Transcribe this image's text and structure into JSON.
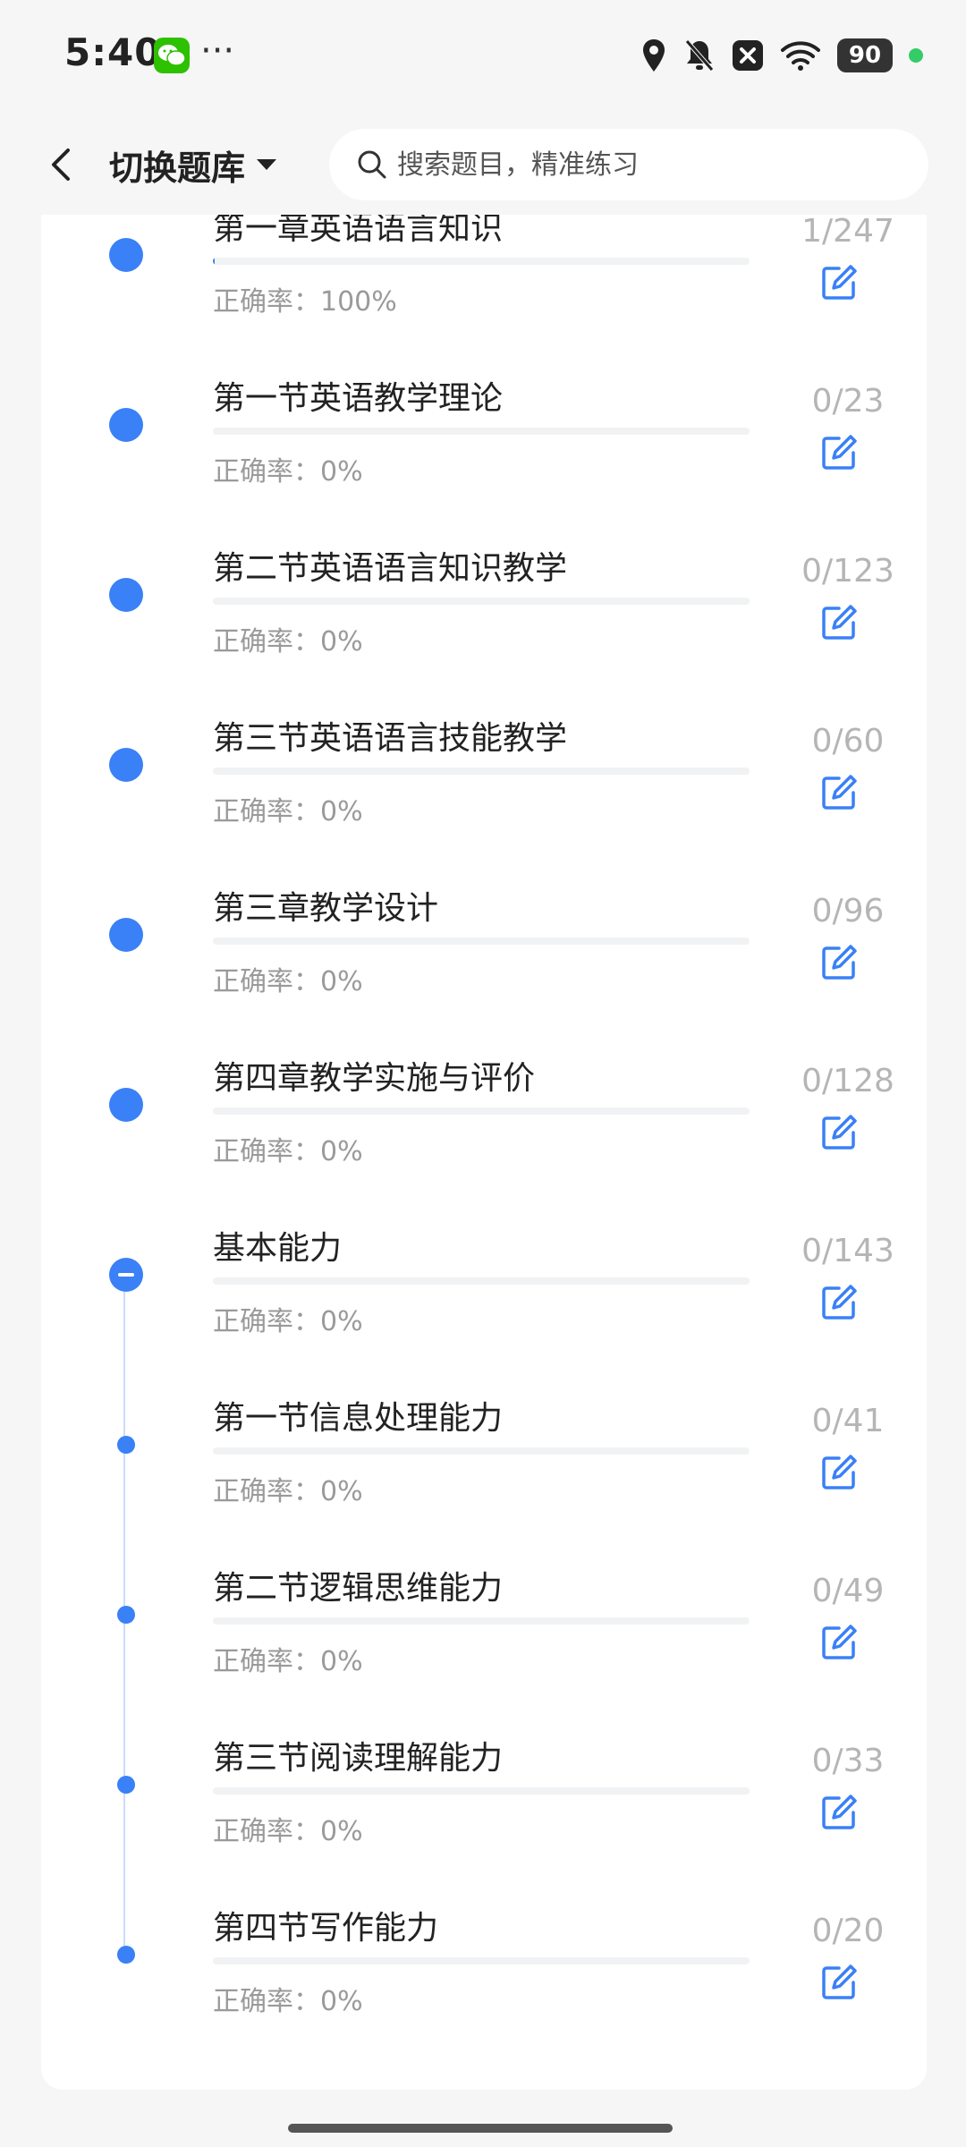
{
  "status_bar": {
    "time": "5:40",
    "dots": "···",
    "battery": "90"
  },
  "header": {
    "bank_switch_label": "切换题库",
    "search_placeholder": "搜索题目，精准练习"
  },
  "rows": [
    {
      "title": "第一章英语语言知识",
      "accuracy": "正确率：100%",
      "count": "1/247",
      "progress": 0.004,
      "dot": "large"
    },
    {
      "title": "第一节英语教学理论",
      "accuracy": "正确率：0%",
      "count": "0/23",
      "progress": 0,
      "dot": "large"
    },
    {
      "title": "第二节英语语言知识教学",
      "accuracy": "正确率：0%",
      "count": "0/123",
      "progress": 0,
      "dot": "large"
    },
    {
      "title": "第三节英语语言技能教学",
      "accuracy": "正确率：0%",
      "count": "0/60",
      "progress": 0,
      "dot": "large"
    },
    {
      "title": "第三章教学设计",
      "accuracy": "正确率：0%",
      "count": "0/96",
      "progress": 0,
      "dot": "large"
    },
    {
      "title": "第四章教学实施与评价",
      "accuracy": "正确率：0%",
      "count": "0/128",
      "progress": 0,
      "dot": "large"
    },
    {
      "title": "基本能力",
      "accuracy": "正确率：0%",
      "count": "0/143",
      "progress": 0,
      "dot": "collapse"
    },
    {
      "title": "第一节信息处理能力",
      "accuracy": "正确率：0%",
      "count": "0/41",
      "progress": 0,
      "dot": "small"
    },
    {
      "title": "第二节逻辑思维能力",
      "accuracy": "正确率：0%",
      "count": "0/49",
      "progress": 0,
      "dot": "small"
    },
    {
      "title": "第三节阅读理解能力",
      "accuracy": "正确率：0%",
      "count": "0/33",
      "progress": 0,
      "dot": "small"
    },
    {
      "title": "第四节写作能力",
      "accuracy": "正确率：0%",
      "count": "0/20",
      "progress": 0,
      "dot": "small"
    }
  ],
  "colors": {
    "accent": "#3a80f7",
    "muted_text": "#9a9a9a",
    "count_text": "#b5b5b5"
  }
}
